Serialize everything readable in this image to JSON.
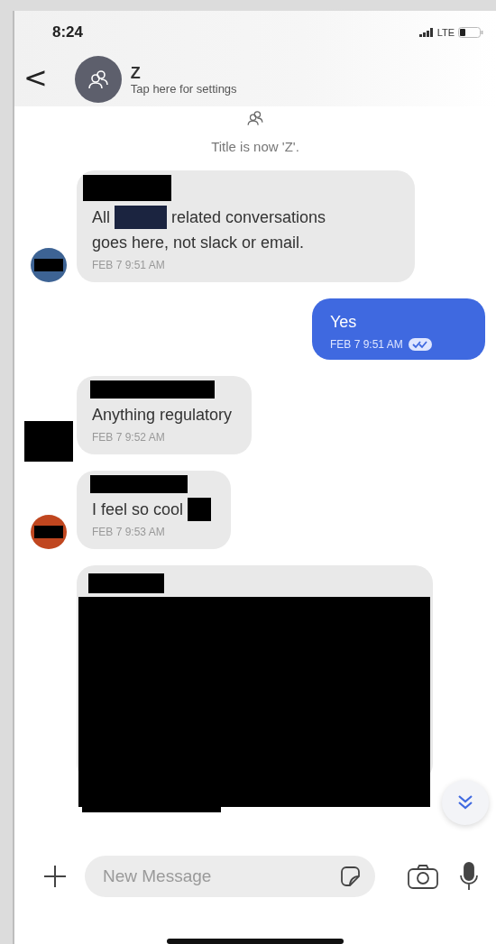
{
  "status_bar": {
    "time": "8:24",
    "network": "LTE"
  },
  "header": {
    "back": "<",
    "title": "Z",
    "subtitle": "Tap here for settings"
  },
  "system_message": {
    "text": "Title is now 'Z'."
  },
  "messages": [
    {
      "kind": "incoming",
      "avatar": {
        "kind": "color",
        "color": "#3d6394"
      },
      "sender_redacted": true,
      "parts": [
        {
          "kind": "text",
          "text": "All"
        },
        {
          "kind": "redaction"
        },
        {
          "kind": "text",
          "text": "related conversations"
        },
        {
          "kind": "text",
          "text": "goes here, not slack or email."
        }
      ],
      "time": "FEB 7 9:51 AM"
    },
    {
      "kind": "outgoing",
      "parts": [
        {
          "kind": "text",
          "text": "Yes"
        }
      ],
      "time": "FEB 7 9:51 AM",
      "read": true
    },
    {
      "kind": "incoming",
      "avatar": {
        "kind": "redacted"
      },
      "sender_redacted": true,
      "parts": [
        {
          "kind": "text",
          "text": "Anything regulatory"
        }
      ],
      "time": "FEB 7 9:52 AM"
    },
    {
      "kind": "incoming",
      "avatar": {
        "kind": "color",
        "color": "#c0461f"
      },
      "sender_redacted": true,
      "parts": [
        {
          "kind": "text",
          "text": "I feel so cool"
        },
        {
          "kind": "redaction"
        }
      ],
      "time": "FEB 7 9:53 AM"
    },
    {
      "kind": "incoming",
      "sender_redacted": true,
      "parts": [
        {
          "kind": "redacted-image"
        }
      ]
    },
    {
      "kind": "cut-off",
      "sender_redacted": true
    }
  ],
  "composer": {
    "placeholder": "New Message"
  }
}
